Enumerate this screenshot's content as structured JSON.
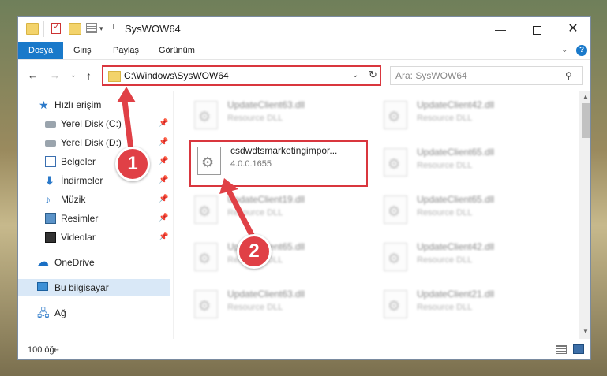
{
  "window": {
    "title": "SysWOW64",
    "controls": {
      "minimize": "—",
      "maximize": "",
      "close": "✕"
    }
  },
  "ribbon": {
    "tabs": [
      {
        "label": "Dosya",
        "active": true
      },
      {
        "label": "Giriş"
      },
      {
        "label": "Paylaş"
      },
      {
        "label": "Görünüm"
      }
    ]
  },
  "address": {
    "path": "C:\\Windows\\SysWOW64",
    "search_placeholder": "Ara: SysWOW64"
  },
  "sidebar": {
    "items": [
      {
        "label": "Hızlı erişim",
        "icon": "star-icon"
      },
      {
        "label": "Yerel Disk (C:)",
        "icon": "disk-icon",
        "pinned": true
      },
      {
        "label": "Yerel Disk (D:)",
        "icon": "disk-icon",
        "pinned": true
      },
      {
        "label": "Belgeler",
        "icon": "documents-icon",
        "pinned": true
      },
      {
        "label": "İndirmeler",
        "icon": "download-icon",
        "pinned": true
      },
      {
        "label": "Müzik",
        "icon": "music-icon",
        "pinned": true
      },
      {
        "label": "Resimler",
        "icon": "pictures-icon",
        "pinned": true
      },
      {
        "label": "Videolar",
        "icon": "videos-icon",
        "pinned": true
      },
      {
        "label": "OneDrive",
        "icon": "cloud-icon"
      },
      {
        "label": "Bu bilgisayar",
        "icon": "computer-icon",
        "selected": true
      },
      {
        "label": "Ağ",
        "icon": "network-icon"
      }
    ]
  },
  "files": [
    {
      "name": "UpdateClient63.dll",
      "meta": "Resource DLL"
    },
    {
      "name": "UpdateClient42.dll",
      "meta": "Resource DLL"
    },
    {
      "name": "csdwdtsmarketingimpor...",
      "meta": "4.0.0.1655"
    },
    {
      "name": "UpdateClient65.dll",
      "meta": "Resource DLL"
    },
    {
      "name": "UpdateClient19.dll",
      "meta": "Resource DLL"
    },
    {
      "name": "UpdateClient65.dll",
      "meta": "Resource DLL"
    },
    {
      "name": "UpdateClient65.dll",
      "meta": "Resource DLL"
    },
    {
      "name": "UpdateClient42.dll",
      "meta": "Resource DLL"
    },
    {
      "name": "UpdateClient63.dll",
      "meta": "Resource DLL"
    },
    {
      "name": "UpdateClient21.dll",
      "meta": "Resource DLL"
    }
  ],
  "status": {
    "item_count": "100 öğe"
  },
  "callouts": [
    {
      "number": "1"
    },
    {
      "number": "2"
    }
  ],
  "colors": {
    "accent": "#1979ca",
    "highlight": "#d9363e"
  }
}
